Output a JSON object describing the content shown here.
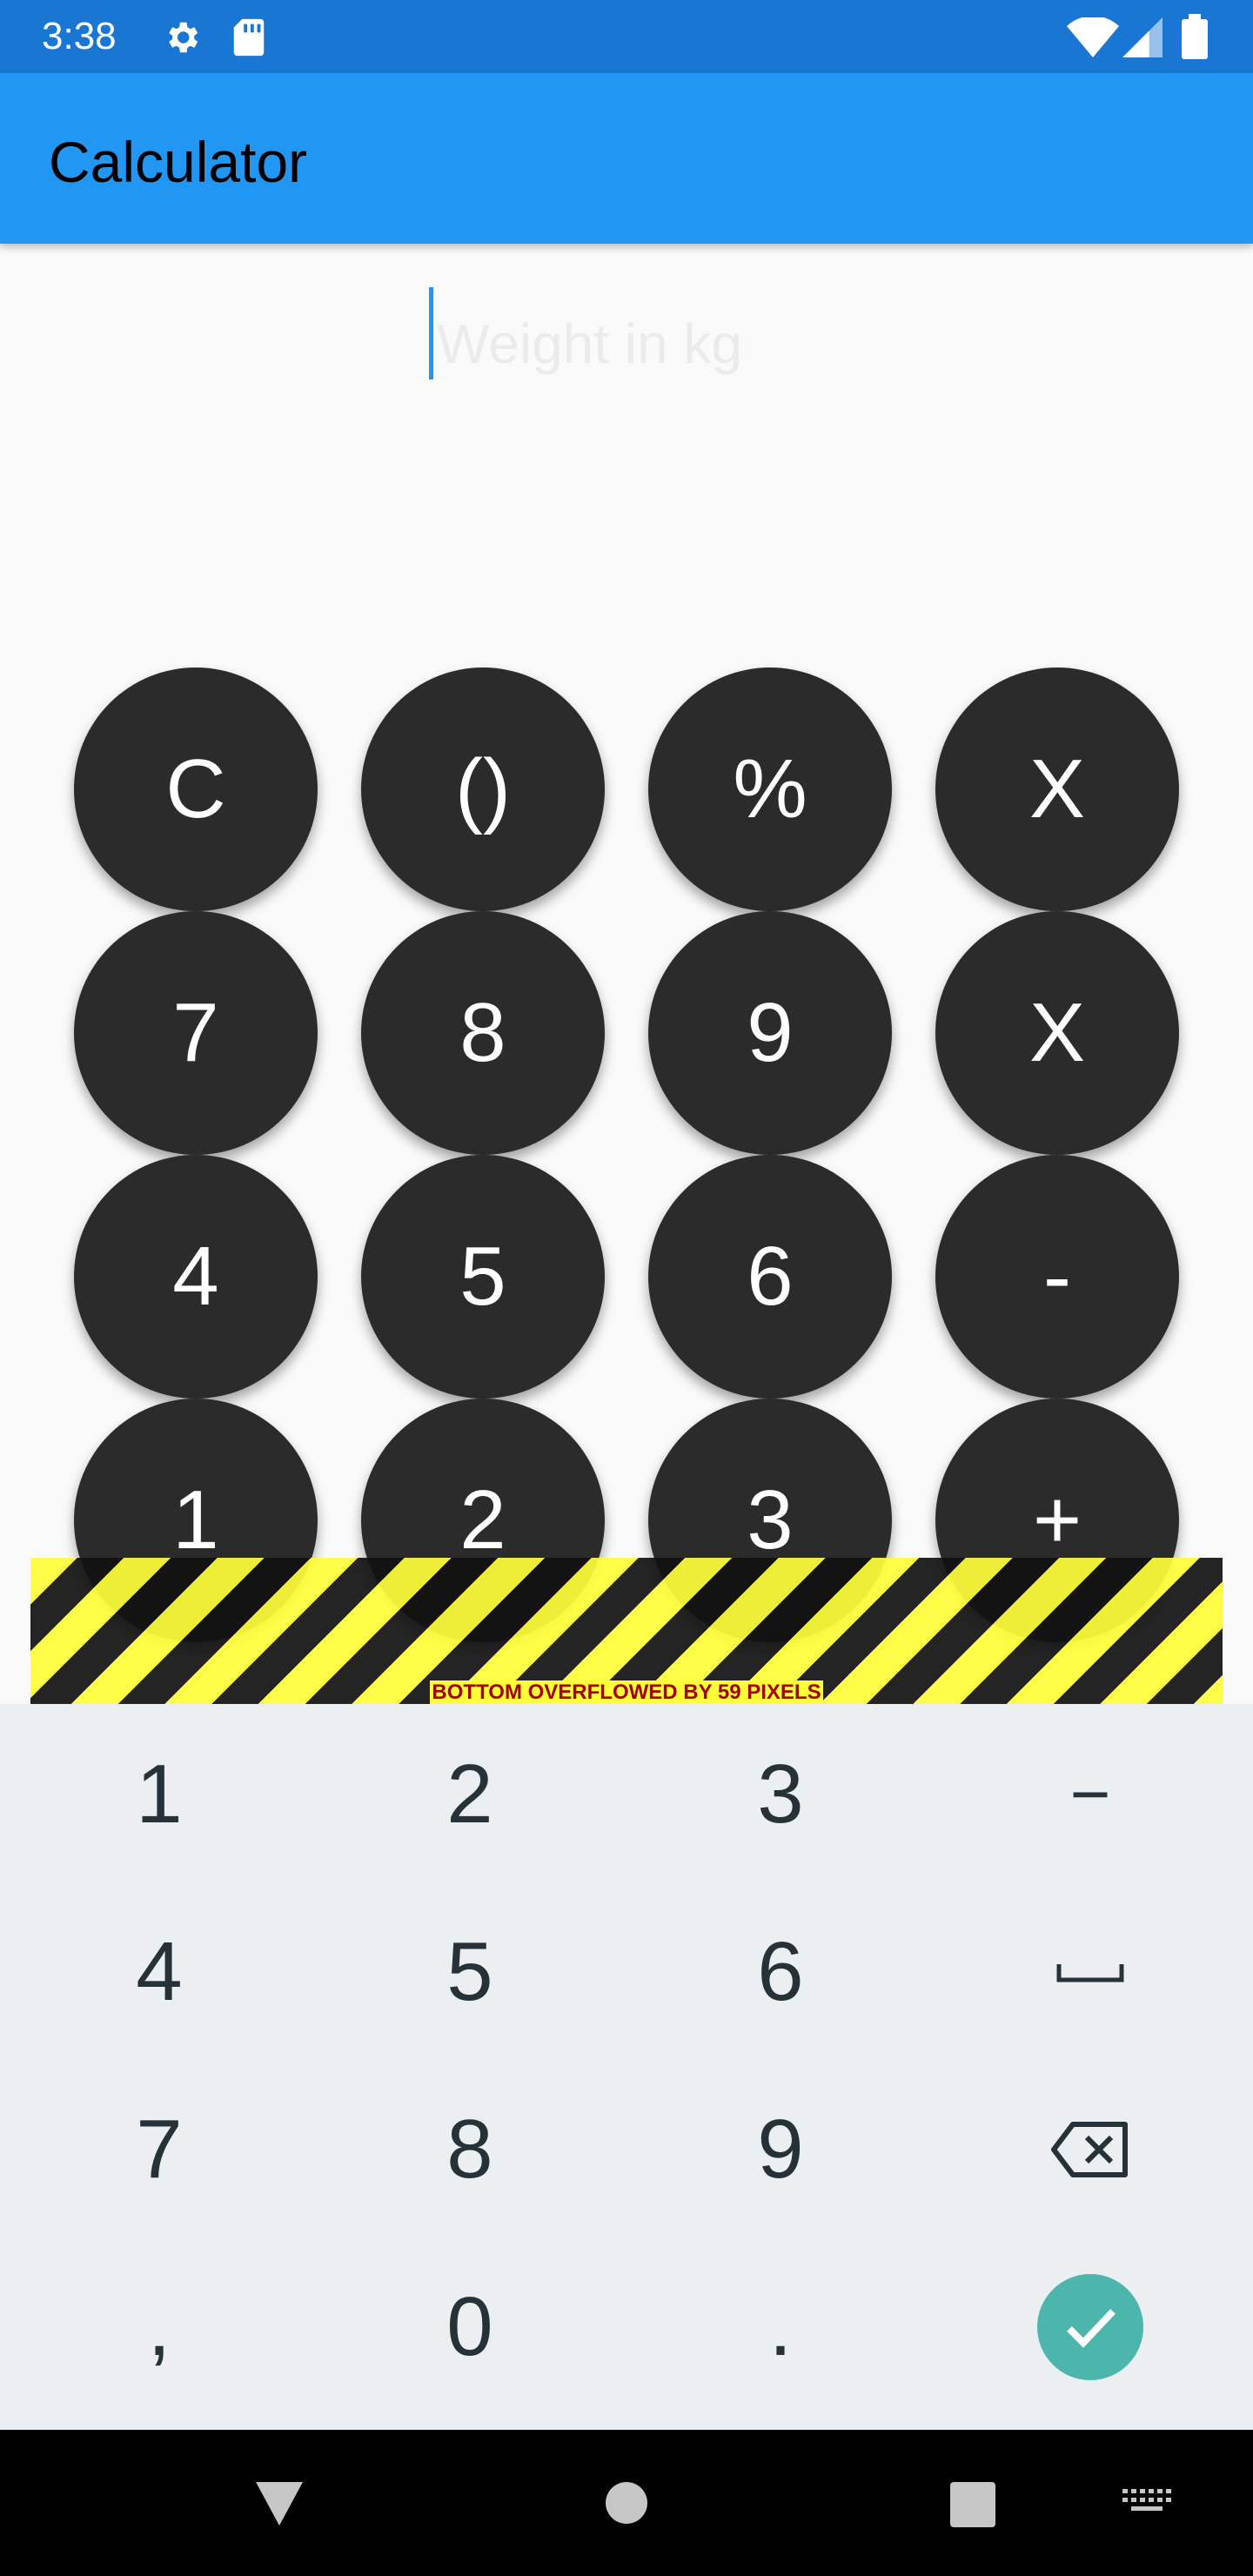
{
  "status_bar": {
    "time": "3:38",
    "icons": [
      "gear-icon",
      "sd-card-icon",
      "wifi-icon",
      "signal-icon",
      "battery-icon"
    ]
  },
  "app_bar": {
    "title": "Calculator",
    "color": "#2196f3"
  },
  "input": {
    "placeholder": "Weight in kg",
    "value": ""
  },
  "calculator_keys": [
    [
      "C",
      "()",
      "%",
      "X"
    ],
    [
      "7",
      "8",
      "9",
      "X"
    ],
    [
      "4",
      "5",
      "6",
      "-"
    ],
    [
      "1",
      "2",
      "3",
      "+"
    ]
  ],
  "overflow_warning": "BOTTOM OVERFLOWED BY 59 PIXELS",
  "keyboard": {
    "rows": [
      [
        "1",
        "2",
        "3",
        "−"
      ],
      [
        "4",
        "5",
        "6",
        "space-icon"
      ],
      [
        "7",
        "8",
        "9",
        "backspace-icon"
      ],
      [
        ",",
        "0",
        ".",
        "done-check-icon"
      ]
    ],
    "accent": "#4db6ac"
  },
  "nav_bar": {
    "icons": [
      "back-icon",
      "home-icon",
      "recents-icon",
      "keyboard-icon"
    ]
  },
  "colors": {
    "status_bar": "#1976d2",
    "key_bg": "#2b2b2b",
    "keyboard_bg": "#eceff1"
  }
}
